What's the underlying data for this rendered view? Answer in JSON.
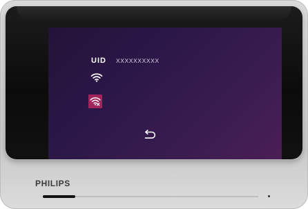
{
  "device": {
    "brand": "PHILIPS",
    "accent_color": "#a2245d",
    "screen_color": "#2b1748"
  },
  "screen": {
    "uid_label": "UID",
    "uid_value": "XXXXXXXXXX",
    "icons": [
      "wifi-icon",
      "wifi-setup-icon",
      "back-arrow-icon"
    ]
  },
  "progress": {
    "fraction": 0.15
  }
}
